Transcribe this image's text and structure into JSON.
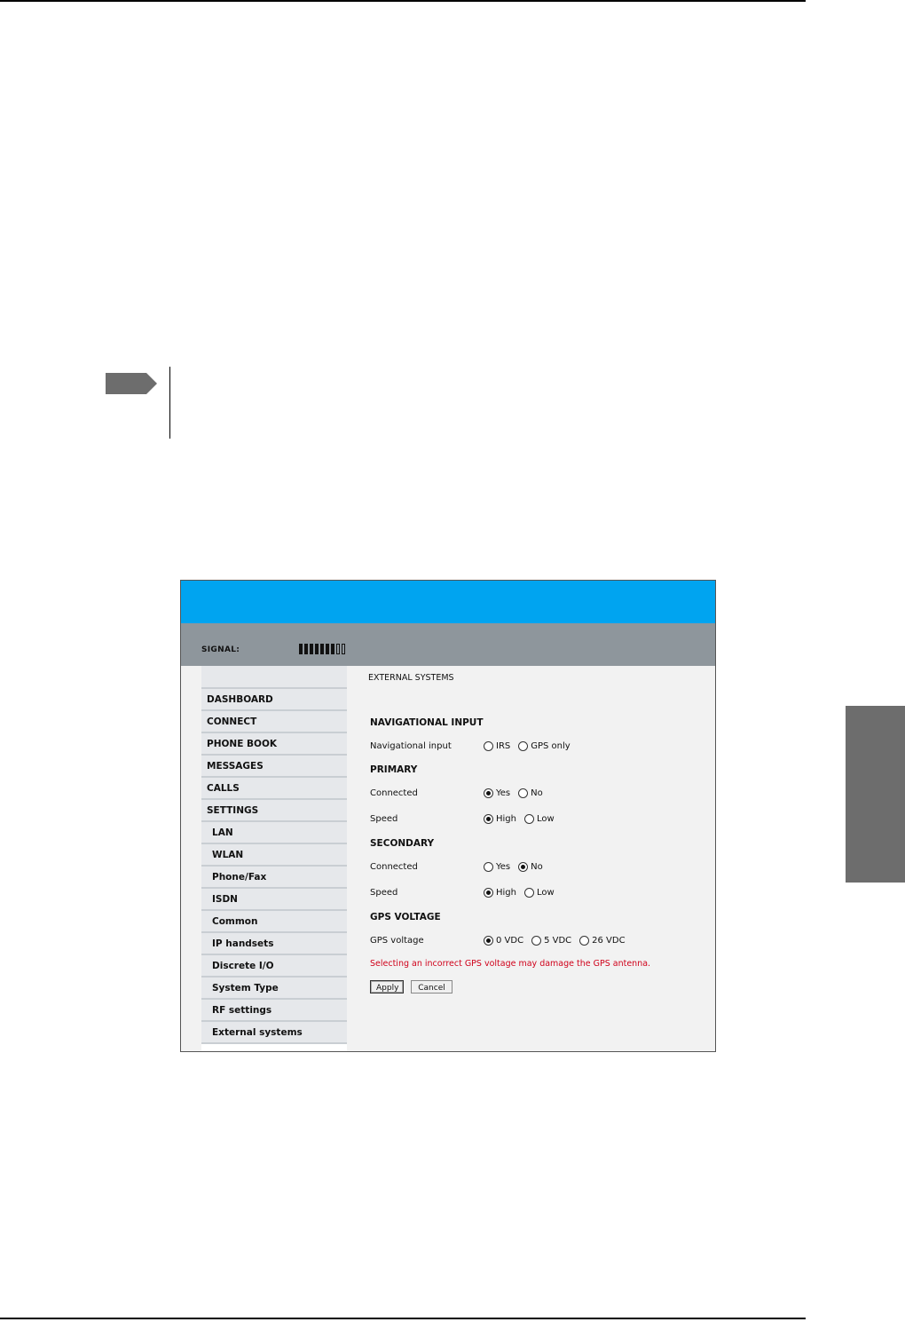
{
  "document": {
    "side_tab_color": "#6d6d6d",
    "note_marker_color": "#6d6d6d"
  },
  "app": {
    "header_color": "#00a4f0",
    "subheader_color": "#8e969c",
    "signal": {
      "label": "SIGNAL:",
      "level": 7,
      "max": 9
    },
    "sidebar": {
      "items": [
        {
          "label": "DASHBOARD",
          "sub": false
        },
        {
          "label": "CONNECT",
          "sub": false
        },
        {
          "label": "PHONE BOOK",
          "sub": false
        },
        {
          "label": "MESSAGES",
          "sub": false
        },
        {
          "label": "CALLS",
          "sub": false
        },
        {
          "label": "SETTINGS",
          "sub": false
        },
        {
          "label": "LAN",
          "sub": true
        },
        {
          "label": "WLAN",
          "sub": true
        },
        {
          "label": "Phone/Fax",
          "sub": true
        },
        {
          "label": "ISDN",
          "sub": true
        },
        {
          "label": "Common",
          "sub": true
        },
        {
          "label": "IP handsets",
          "sub": true
        },
        {
          "label": "Discrete I/O",
          "sub": true
        },
        {
          "label": "System Type",
          "sub": true
        },
        {
          "label": "RF settings",
          "sub": true
        },
        {
          "label": "External systems",
          "sub": true
        }
      ]
    },
    "content": {
      "page_title": "EXTERNAL SYSTEMS",
      "nav_section": "NAVIGATIONAL INPUT",
      "nav_label": "Navigational input",
      "nav_options": [
        "IRS",
        "GPS only"
      ],
      "primary_section": "PRIMARY",
      "primary_connected_label": "Connected",
      "primary_connected_options": [
        "Yes",
        "No"
      ],
      "primary_speed_label": "Speed",
      "primary_speed_options": [
        "High",
        "Low"
      ],
      "secondary_section": "SECONDARY",
      "secondary_connected_label": "Connected",
      "secondary_connected_options": [
        "Yes",
        "No"
      ],
      "secondary_speed_label": "Speed",
      "secondary_speed_options": [
        "High",
        "Low"
      ],
      "gps_section": "GPS VOLTAGE",
      "gps_label": "GPS voltage",
      "gps_options": [
        "0 VDC",
        "5 VDC",
        "26 VDC"
      ],
      "warning": "Selecting an incorrect GPS voltage may damage the GPS antenna.",
      "warning_color": "#d0021b",
      "apply_label": "Apply",
      "cancel_label": "Cancel"
    }
  }
}
